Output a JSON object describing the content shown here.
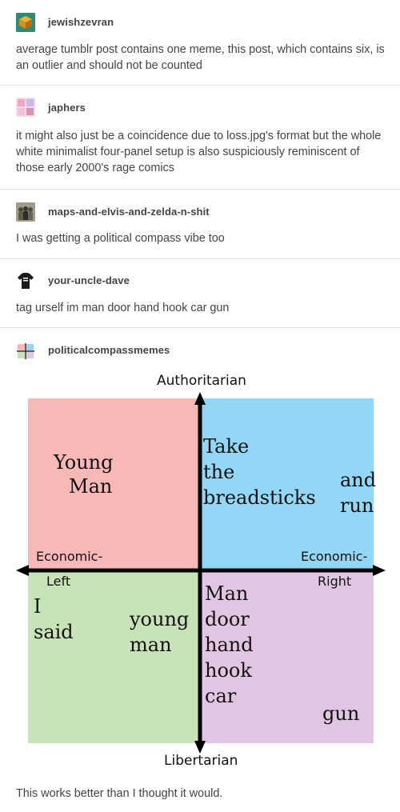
{
  "posts": [
    {
      "username": "jewishzevran",
      "avatar_icon": "cube-icon",
      "text": "average tumblr post contains one meme, this post, which contains six, is an outlier and should not be counted"
    },
    {
      "username": "japhers",
      "avatar_icon": "anime-collage-icon",
      "text": "it might also just be a coincidence due to loss.jpg's format but the whole white minimalist four-panel setup is also suspiciously reminiscent of those early 2000's rage comics"
    },
    {
      "username": "maps-and-elvis-and-zelda-n-shit",
      "avatar_icon": "group-photo-icon",
      "text": "I was getting a political compass vibe too"
    },
    {
      "username": "your-uncle-dave",
      "avatar_icon": "tshirt-icon",
      "text": "tag urself im man door hand hook car gun"
    },
    {
      "username": "politicalcompassmemes",
      "avatar_icon": "compass-mini-icon",
      "text": "This works better than I thought it would."
    }
  ],
  "compass": {
    "top_label": "Authoritarian",
    "bottom_label": "Libertarian",
    "left_label_1": "Economic-",
    "left_label_2": "Left",
    "right_label_1": "Economic-",
    "right_label_2": "Right",
    "colors": {
      "top_left": "#f7b8b8",
      "top_right": "#93d6f5",
      "bottom_left": "#c8e3b8",
      "bottom_right": "#e0c6e2"
    },
    "tl_text_1": "Young",
    "tl_text_2": "Man",
    "tr_text_1": "Take",
    "tr_text_2": "the",
    "tr_text_3": "breadsticks",
    "tr_text_4": "and",
    "tr_text_5": "run",
    "bl_text_1": "I",
    "bl_text_2": "said",
    "bl_text_3": "young",
    "bl_text_4": "man",
    "br_text_1": "Man",
    "br_text_2": "door",
    "br_text_3": "hand",
    "br_text_4": "hook",
    "br_text_5": "car",
    "br_text_6": "gun"
  }
}
